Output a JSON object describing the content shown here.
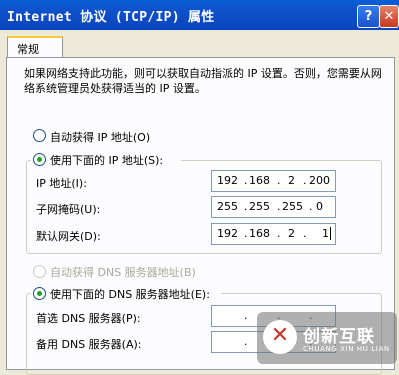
{
  "window": {
    "title": "Internet 协议 (TCP/IP) 属性",
    "help_glyph": "?",
    "close_glyph": "✕"
  },
  "tab": {
    "label": "常规"
  },
  "description": "如果网络支持此功能，则可以获取自动指派的 IP 设置。否则，您需要从网络系统管理员处获得适当的 IP 设置。",
  "ip_section": {
    "auto_label": "自动获得 IP 地址(O)",
    "manual_label": "使用下面的 IP 地址(S):",
    "selected": "manual",
    "ip": {
      "label": "IP 地址(I):",
      "octets": [
        "192",
        "168",
        "2",
        "200"
      ]
    },
    "mask": {
      "label": "子网掩码(U):",
      "octets": [
        "255",
        "255",
        "255",
        "0"
      ]
    },
    "gateway": {
      "label": "默认网关(D):",
      "octets": [
        "192",
        "168",
        "2",
        "1"
      ]
    }
  },
  "dns_section": {
    "auto_label": "自动获得 DNS 服务器地址(B)",
    "manual_label": "使用下面的 DNS 服务器地址(E):",
    "selected": "manual",
    "preferred": {
      "label": "首选 DNS 服务器(P):",
      "octets": [
        "",
        "",
        "",
        ""
      ]
    },
    "alternate": {
      "label": "备用 DNS 服务器(A):",
      "octets": [
        "",
        "",
        "",
        ""
      ]
    }
  },
  "watermark": {
    "glyph": "✕",
    "text": "创新互联",
    "subtext": "CHUANG XIN HU LIAN"
  }
}
